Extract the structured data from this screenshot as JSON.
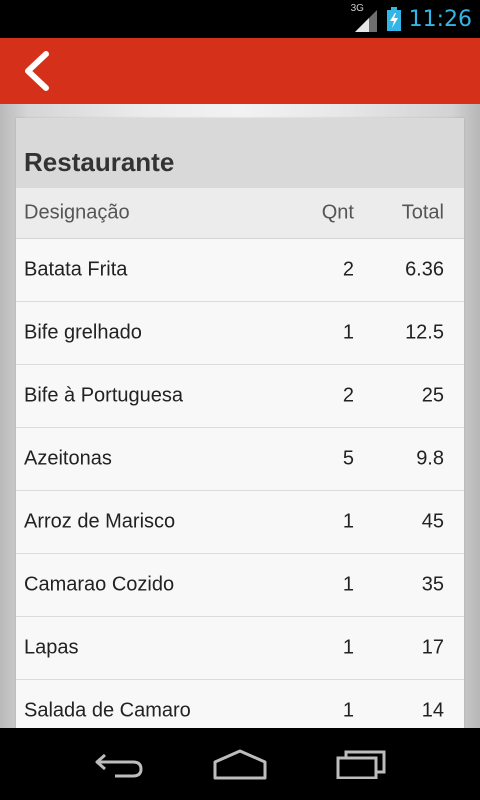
{
  "status_bar": {
    "network": "3G",
    "time": "11:26"
  },
  "action_bar": {
    "back_icon": "chevron-left-icon"
  },
  "card": {
    "title": "Restaurante",
    "columns": {
      "name": "Designação",
      "qty": "Qnt",
      "total": "Total"
    },
    "rows": [
      {
        "name": "Batata Frita",
        "qty": "2",
        "total": "6.36"
      },
      {
        "name": "Bife grelhado",
        "qty": "1",
        "total": "12.5"
      },
      {
        "name": "Bife à Portuguesa",
        "qty": "2",
        "total": "25"
      },
      {
        "name": "Azeitonas",
        "qty": "5",
        "total": "9.8"
      },
      {
        "name": "Arroz de Marisco",
        "qty": "1",
        "total": "45"
      },
      {
        "name": "Camarao Cozido",
        "qty": "1",
        "total": "35"
      },
      {
        "name": "Lapas",
        "qty": "1",
        "total": "17"
      },
      {
        "name": "Salada de Camaro",
        "qty": "1",
        "total": "14"
      }
    ]
  },
  "colors": {
    "action_bar": "#d5311a",
    "status_accent": "#33b5e5"
  },
  "nav_bar": {
    "back_icon": "back-icon",
    "home_icon": "home-icon",
    "recents_icon": "recent-apps-icon"
  }
}
